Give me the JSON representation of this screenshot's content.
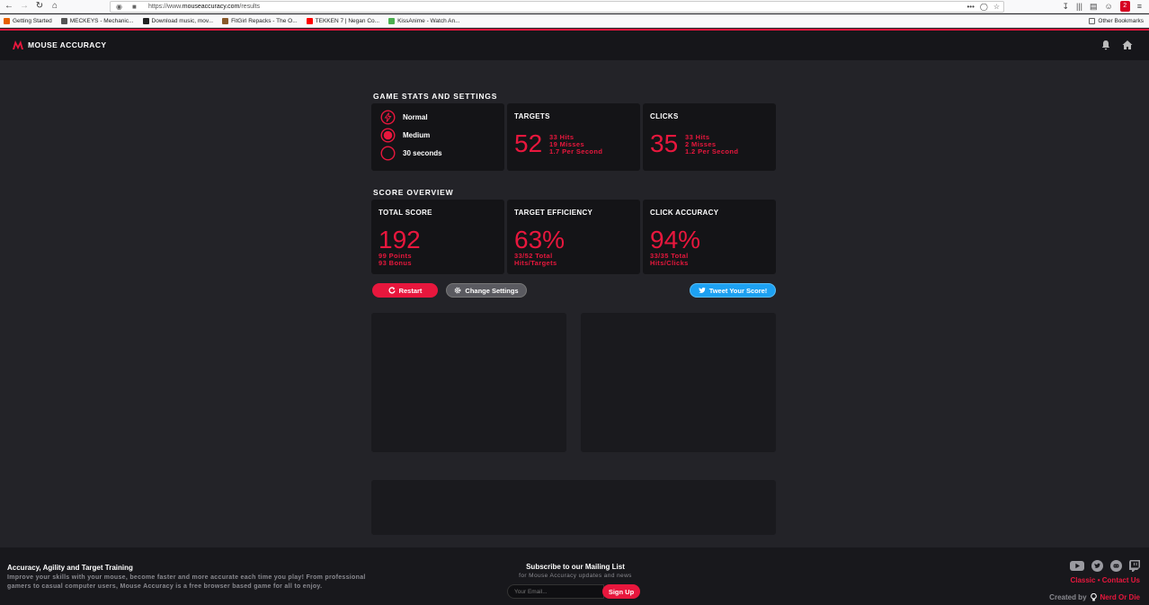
{
  "browser": {
    "url_prefix": "https://www.",
    "url_host": "mouseaccuracy.com",
    "url_path": "/results",
    "menu_dots": "•••",
    "ext_badge": "2",
    "bookmarks": [
      {
        "label": "Getting Started",
        "color": "#e66000"
      },
      {
        "label": "MECKEYS - Mechanic...",
        "color": "#555555"
      },
      {
        "label": "Download music, mov...",
        "color": "#222222"
      },
      {
        "label": "FitGirl Repacks - The O...",
        "color": "#8a5a2b"
      },
      {
        "label": "TEKKEN 7 | Negan Co...",
        "color": "#ff0000"
      },
      {
        "label": "KissAnime - Watch An...",
        "color": "#4caf50"
      }
    ],
    "other_bookmarks": "Other Bookmarks"
  },
  "header": {
    "logo_text": "MOUSE ACCURACY"
  },
  "stats_section": {
    "title": "GAME STATS AND SETTINGS",
    "settings": [
      {
        "label": "Normal",
        "icon": "lightning-icon"
      },
      {
        "label": "Medium",
        "icon": "target-size-icon"
      },
      {
        "label": "30 seconds",
        "icon": "timer-icon"
      }
    ],
    "targets": {
      "title": "TARGETS",
      "value": "52",
      "lines": [
        "33 Hits",
        "19 Misses",
        "1.7 Per Second"
      ]
    },
    "clicks": {
      "title": "CLICKS",
      "value": "35",
      "lines": [
        "33 Hits",
        "2 Misses",
        "1.2 Per Second"
      ]
    }
  },
  "score_section": {
    "title": "SCORE OVERVIEW",
    "total": {
      "title": "TOTAL SCORE",
      "value": "192",
      "lines": [
        "99 Points",
        "93 Bonus"
      ]
    },
    "efficiency": {
      "title": "TARGET EFFICIENCY",
      "value": "63%",
      "lines": [
        "33/52 Total",
        "Hits/Targets"
      ]
    },
    "accuracy": {
      "title": "CLICK ACCURACY",
      "value": "94%",
      "lines": [
        "33/35 Total",
        "Hits/Clicks"
      ]
    }
  },
  "actions": {
    "restart": "Restart",
    "change_settings": "Change Settings",
    "tweet": "Tweet Your Score!"
  },
  "footer": {
    "title": "Accuracy, Agility and Target Training",
    "description": "Improve your skills with your mouse, become faster and more accurate each time you play! From professional gamers to casual computer users, Mouse Accuracy is a free browser based game for all to enjoy.",
    "mailing_title": "Subscribe to our Mailing List",
    "mailing_sub": "for Mouse Accuracy updates and news",
    "email_placeholder": "Your Email...",
    "signup": "Sign Up",
    "link_classic": "Classic",
    "link_separator": "•",
    "link_contact": "Contact Us",
    "created_by": "Created by",
    "brand": "Nerd Or Die"
  },
  "colors": {
    "accent": "#e8173d",
    "background": "#232328",
    "card": "#141417",
    "twitter": "#1da1f2"
  }
}
